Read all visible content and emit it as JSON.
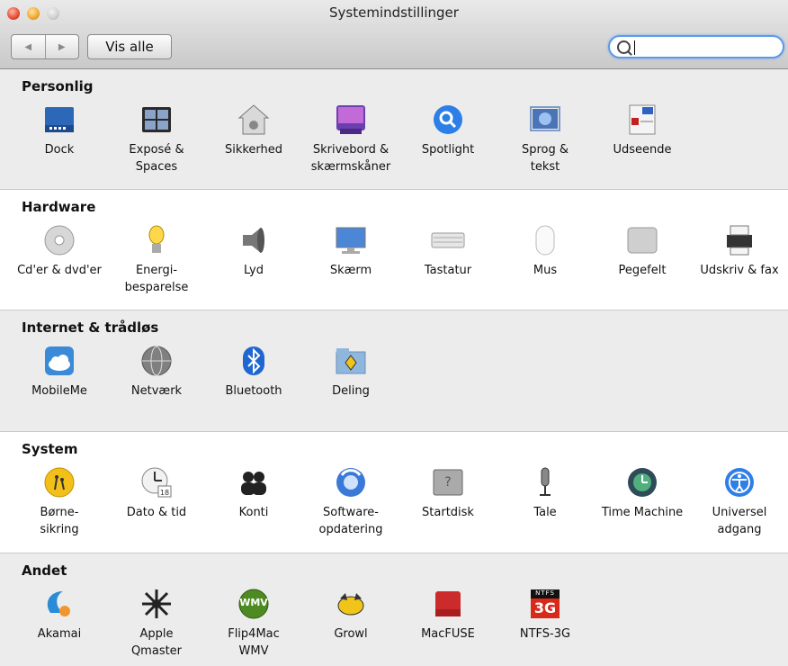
{
  "window": {
    "title": "Systemindstillinger"
  },
  "toolbar": {
    "show_all_label": "Vis alle",
    "back_arrow": "◀",
    "forward_arrow": "▶"
  },
  "search": {
    "value": "",
    "placeholder": ""
  },
  "sections": [
    {
      "title": "Personlig",
      "items": [
        {
          "label": "Dock",
          "icon": "dock-icon"
        },
        {
          "label": "Exposé &\nSpaces",
          "icon": "expose-spaces-icon"
        },
        {
          "label": "Sikkerhed",
          "icon": "security-house-icon"
        },
        {
          "label": "Skrivebord &\nskærmskåner",
          "icon": "desktop-screensaver-icon"
        },
        {
          "label": "Spotlight",
          "icon": "spotlight-icon"
        },
        {
          "label": "Sprog &\ntekst",
          "icon": "language-text-icon"
        },
        {
          "label": "Udseende",
          "icon": "appearance-icon"
        }
      ]
    },
    {
      "title": "Hardware",
      "items": [
        {
          "label": "Cd'er & dvd'er",
          "icon": "cd-dvd-icon"
        },
        {
          "label": "Energi-\nbesparelse",
          "icon": "energy-bulb-icon"
        },
        {
          "label": "Lyd",
          "icon": "speaker-icon"
        },
        {
          "label": "Skærm",
          "icon": "display-icon"
        },
        {
          "label": "Tastatur",
          "icon": "keyboard-icon"
        },
        {
          "label": "Mus",
          "icon": "mouse-icon"
        },
        {
          "label": "Pegefelt",
          "icon": "trackpad-icon"
        },
        {
          "label": "Udskriv & fax",
          "icon": "printer-icon"
        }
      ]
    },
    {
      "title": "Internet & trådløs",
      "items": [
        {
          "label": "MobileMe",
          "icon": "mobileme-cloud-icon"
        },
        {
          "label": "Netværk",
          "icon": "network-globe-icon"
        },
        {
          "label": "Bluetooth",
          "icon": "bluetooth-icon"
        },
        {
          "label": "Deling",
          "icon": "sharing-folder-icon"
        }
      ]
    },
    {
      "title": "System",
      "items": [
        {
          "label": "Børne-\nsikring",
          "icon": "parental-controls-icon"
        },
        {
          "label": "Dato & tid",
          "icon": "date-time-clock-icon"
        },
        {
          "label": "Konti",
          "icon": "accounts-icon"
        },
        {
          "label": "Software-\nopdatering",
          "icon": "software-update-icon"
        },
        {
          "label": "Startdisk",
          "icon": "startup-disk-icon"
        },
        {
          "label": "Tale",
          "icon": "speech-microphone-icon"
        },
        {
          "label": "Time Machine",
          "icon": "time-machine-icon"
        },
        {
          "label": "Universel\nadgang",
          "icon": "universal-access-icon"
        }
      ]
    },
    {
      "title": "Andet",
      "items": [
        {
          "label": "Akamai",
          "icon": "akamai-icon"
        },
        {
          "label": "Apple\nQmaster",
          "icon": "qmaster-icon"
        },
        {
          "label": "Flip4Mac\nWMV",
          "icon": "flip4mac-wmv-icon",
          "badge": "WMV"
        },
        {
          "label": "Growl",
          "icon": "growl-icon"
        },
        {
          "label": "MacFUSE",
          "icon": "macfuse-icon"
        },
        {
          "label": "NTFS-3G",
          "icon": "ntfs-3g-icon",
          "badge_top": "NTFS",
          "badge": "3G"
        }
      ]
    }
  ]
}
